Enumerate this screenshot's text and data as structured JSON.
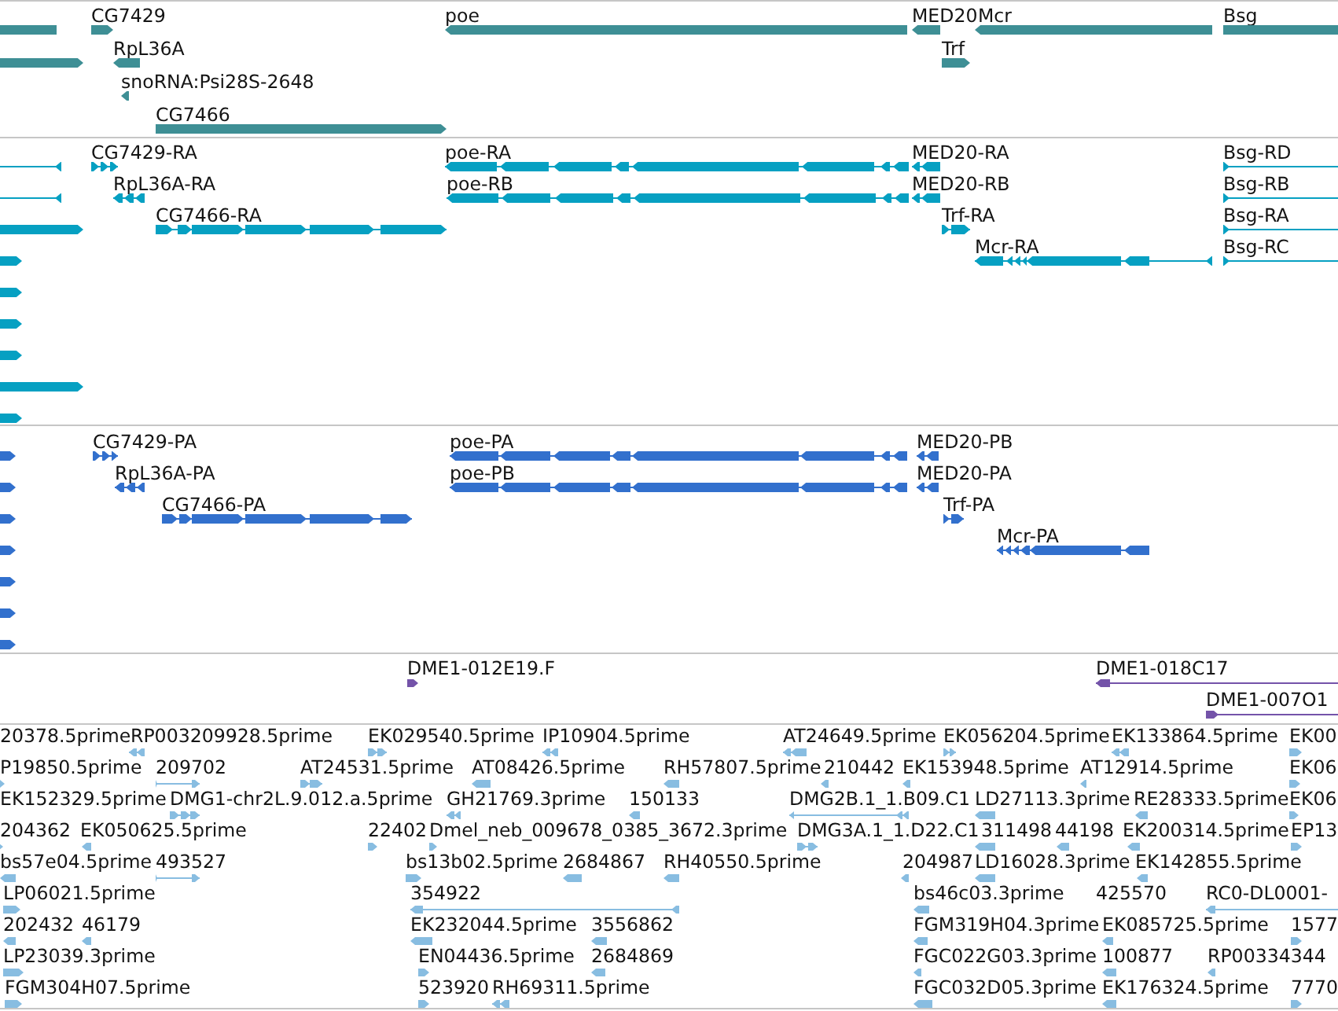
{
  "tracks": [
    {
      "kind": "gene",
      "features": [
        {
          "reverse": true
        },
        {
          "label": "CG7429",
          "reverse": false
        },
        {
          "label": "poe",
          "reverse": true
        },
        {
          "label": "MED20",
          "reverse": true
        },
        {
          "label": "Mcr",
          "reverse": true
        },
        {
          "label": "Bsg",
          "reverse": false
        },
        {
          "reverse": false
        },
        {
          "label": "RpL36A",
          "reverse": true
        },
        {
          "label": "Trf",
          "reverse": false
        },
        {
          "label": "snoRNA:Psi28S-2648",
          "reverse": true
        },
        {
          "label": "CG7466",
          "reverse": false
        }
      ]
    },
    {
      "kind": "transcript",
      "features": [
        {
          "reverse": true
        },
        {
          "label": "CG7429-RA",
          "reverse": false
        },
        {
          "label": "poe-RA",
          "reverse": true
        },
        {
          "label": "MED20-RA",
          "reverse": true
        },
        {
          "label": "Bsg-RD",
          "reverse": false
        },
        {
          "reverse": true
        },
        {
          "label": "RpL36A-RA",
          "reverse": true
        },
        {
          "label": "poe-RB",
          "reverse": true
        },
        {
          "label": "MED20-RB",
          "reverse": true
        },
        {
          "label": "Bsg-RB",
          "reverse": false
        },
        {
          "reverse": false
        },
        {
          "label": "CG7466-RA",
          "reverse": false
        },
        {
          "label": "Trf-RA",
          "reverse": false
        },
        {
          "label": "Bsg-RA",
          "reverse": false
        },
        {
          "reverse": false
        },
        {
          "label": "Mcr-RA",
          "reverse": true
        },
        {
          "label": "Bsg-RC",
          "reverse": false
        },
        {
          "reverse": false
        },
        {
          "reverse": false
        },
        {
          "reverse": false
        },
        {
          "reverse": false
        },
        {
          "reverse": false
        }
      ]
    },
    {
      "kind": "protein",
      "features": [
        {
          "reverse": false
        },
        {
          "label": "CG7429-PA",
          "reverse": false
        },
        {
          "label": "poe-PA",
          "reverse": true
        },
        {
          "label": "MED20-PB",
          "reverse": true
        },
        {
          "reverse": false
        },
        {
          "label": "RpL36A-PA",
          "reverse": true
        },
        {
          "label": "poe-PB",
          "reverse": true
        },
        {
          "label": "MED20-PA",
          "reverse": true
        },
        {
          "reverse": false
        },
        {
          "label": "CG7466-PA",
          "reverse": false
        },
        {
          "label": "Trf-PA",
          "reverse": false
        },
        {
          "reverse": false
        },
        {
          "label": "Mcr-PA",
          "reverse": true
        },
        {
          "reverse": false
        },
        {
          "reverse": false
        },
        {
          "reverse": false
        }
      ]
    },
    {
      "kind": "clone",
      "features": [
        {
          "label": "DME1-012E19.F",
          "reverse": false
        },
        {
          "label": "DME1-018C17",
          "reverse": true
        },
        {
          "label": "DME1-007O1",
          "reverse": false
        }
      ]
    },
    {
      "kind": "est",
      "features": [
        {
          "label": "20378.5prime"
        },
        {
          "label": "RP003209928.5prime",
          "reverse": true
        },
        {
          "label": "EK029540.5prime",
          "reverse": false
        },
        {
          "label": "IP10904.5prime",
          "reverse": true
        },
        {
          "label": "AT24649.5prime",
          "reverse": true
        },
        {
          "label": "EK056204.5prime",
          "reverse": false
        },
        {
          "label": "EK133864.5prime",
          "reverse": true
        },
        {
          "label": "EK00",
          "reverse": false
        },
        {
          "label": "P19850.5prime",
          "reverse": false
        },
        {
          "label": "209702",
          "reverse": false
        },
        {
          "label": "AT24531.5prime",
          "reverse": false
        },
        {
          "label": "AT08426.5prime",
          "reverse": true
        },
        {
          "label": "RH57807.5prime",
          "reverse": true
        },
        {
          "label": "210442",
          "reverse": true
        },
        {
          "label": "EK153948.5prime",
          "reverse": true
        },
        {
          "label": "AT12914.5prime",
          "reverse": true
        },
        {
          "label": "EK06",
          "reverse": false
        },
        {
          "label": "EK152329.5prime"
        },
        {
          "label": "DMG1-chr2L.9.012.a.5prime",
          "reverse": false
        },
        {
          "label": "GH21769.3prime",
          "reverse": true
        },
        {
          "label": "150133",
          "reverse": true
        },
        {
          "label": "DMG2B.1_1.B09.C1",
          "reverse": true
        },
        {
          "label": "LD27113.3prime",
          "reverse": true
        },
        {
          "label": "RE28333.5prime",
          "reverse": true
        },
        {
          "label": "EK06",
          "reverse": false
        },
        {
          "label": "204362",
          "reverse": false
        },
        {
          "label": "EK050625.5prime",
          "reverse": true
        },
        {
          "label": "22402",
          "reverse": false
        },
        {
          "label": "Dmel_neb_009678_0385_3672.3prime",
          "reverse": false
        },
        {
          "label": "DMG3A.1_1.D22.C1",
          "reverse": false
        },
        {
          "label": "311498",
          "reverse": true
        },
        {
          "label": "44198",
          "reverse": true
        },
        {
          "label": "EK200314.5prime",
          "reverse": true
        },
        {
          "label": "EP13",
          "reverse": false
        },
        {
          "label": "bs57e04.5prime",
          "reverse": true
        },
        {
          "label": "493527",
          "reverse": false
        },
        {
          "label": "bs13b02.5prime",
          "reverse": false
        },
        {
          "label": "2684867",
          "reverse": true
        },
        {
          "label": "RH40550.5prime",
          "reverse": true
        },
        {
          "label": "204987",
          "reverse": true
        },
        {
          "label": "LD16028.3prime",
          "reverse": true
        },
        {
          "label": "EK142855.5prime",
          "reverse": true
        },
        {
          "label": "LP06021.5prime",
          "reverse": false
        },
        {
          "label": "354922",
          "reverse": true
        },
        {
          "label": "bs46c03.3prime",
          "reverse": true
        },
        {
          "label": "425570"
        },
        {
          "label": "RC0-DL0001-",
          "reverse": true
        },
        {
          "label": "202432",
          "reverse": true
        },
        {
          "label": "46179",
          "reverse": true
        },
        {
          "label": "EK232044.5prime",
          "reverse": true
        },
        {
          "label": "3556862",
          "reverse": true
        },
        {
          "label": "FGM319H04.3prime",
          "reverse": true
        },
        {
          "label": "EK085725.5prime",
          "reverse": true
        },
        {
          "label": "1577",
          "reverse": false
        },
        {
          "label": "LP23039.3prime",
          "reverse": false
        },
        {
          "label": "EN04436.5prime",
          "reverse": false
        },
        {
          "label": "2684869",
          "reverse": true
        },
        {
          "label": "FGC022G03.3prime",
          "reverse": true
        },
        {
          "label": "100877",
          "reverse": true
        },
        {
          "label": "RP00334344",
          "reverse": true
        },
        {
          "label": "FGM304H07.5prime",
          "reverse": false
        },
        {
          "label": "523920",
          "reverse": false
        },
        {
          "label": "RH69311.5prime",
          "reverse": true
        },
        {
          "label": "FGC032D05.3prime",
          "reverse": true
        },
        {
          "label": "EK176324.5prime",
          "reverse": true
        },
        {
          "label": "7770",
          "reverse": false
        }
      ]
    }
  ]
}
